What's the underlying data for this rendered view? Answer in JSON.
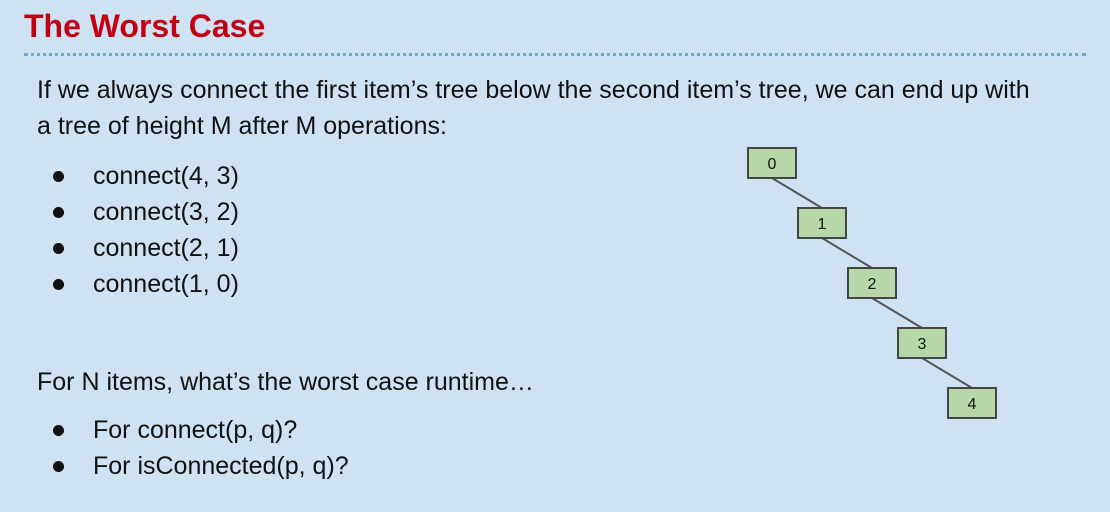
{
  "title": "The Worst Case",
  "intro": "If we always connect the first item’s tree below the second item’s tree, we can end up with a tree of height M after M operations:",
  "operations": [
    "connect(4, 3)",
    "connect(3, 2)",
    "connect(2, 1)",
    "connect(1, 0)"
  ],
  "question": "For N items, what’s the worst case runtime…",
  "question_items": [
    "For connect(p, q)?",
    "For isConnected(p, q)?"
  ],
  "tree": {
    "nodes": [
      "0",
      "1",
      "2",
      "3",
      "4"
    ],
    "edges": [
      [
        "0",
        "1"
      ],
      [
        "1",
        "2"
      ],
      [
        "2",
        "3"
      ],
      [
        "3",
        "4"
      ]
    ]
  },
  "colors": {
    "background": "#cfe2f3",
    "title": "#c00012",
    "node_fill": "#b6d7a8",
    "node_stroke": "#444444",
    "rule": "#6fa8dc"
  }
}
